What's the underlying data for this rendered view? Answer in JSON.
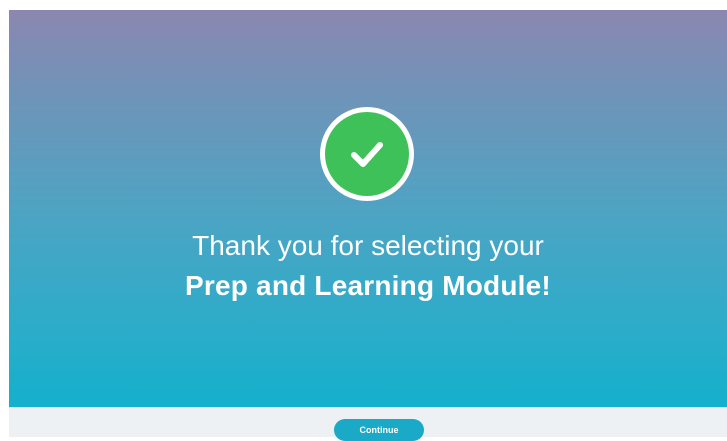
{
  "hero": {
    "icon": "check-circle-icon",
    "icon_color": "#3fc15a",
    "title_line1": "Thank you for selecting your",
    "title_line2": "Prep and Learning Module!"
  },
  "footer": {
    "continue_label": "Continue",
    "button_color": "#1aa9c7"
  }
}
